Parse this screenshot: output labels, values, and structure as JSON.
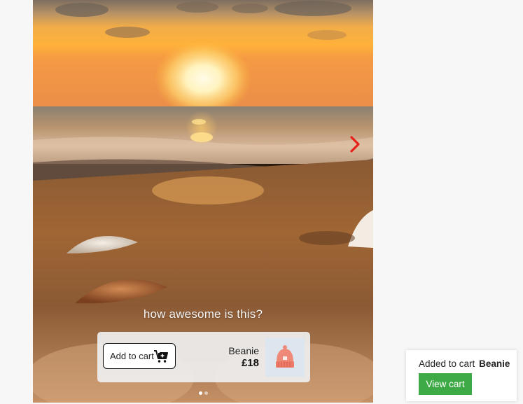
{
  "story": {
    "image_icon": "sunset-beach-photo",
    "caption": "how awesome is this?",
    "next_icon": "chevron-right-icon",
    "accent_color": "#e8201a",
    "slides_total": 2,
    "slide_active": 1
  },
  "product": {
    "add_to_cart_label": "Add to cart",
    "cart_icon": "add-to-cart-icon",
    "name": "Beanie",
    "price": "£18",
    "thumb_icon": "beanie-icon",
    "thumb_color": "#f08a78"
  },
  "toast": {
    "message": "Added to cart",
    "item": "Beanie",
    "view_cart_label": "View cart",
    "button_color": "#3eaa46"
  }
}
